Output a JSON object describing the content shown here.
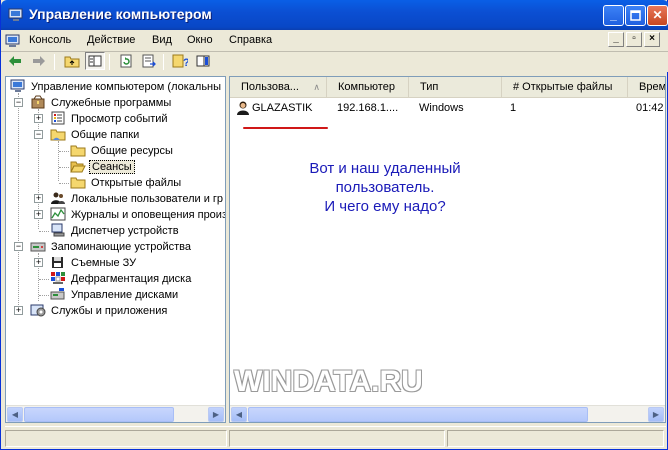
{
  "window": {
    "title": "Управление компьютером"
  },
  "menu": {
    "items": [
      "Консоль",
      "Действие",
      "Вид",
      "Окно",
      "Справка"
    ]
  },
  "tree": {
    "nodes": [
      {
        "label": "Управление компьютером (локальны",
        "icon": "computer-management-icon"
      },
      {
        "label": "Служебные программы",
        "icon": "system-tools-icon"
      },
      {
        "label": "Просмотр событий",
        "icon": "event-viewer-icon"
      },
      {
        "label": "Общие папки",
        "icon": "shared-folders-icon"
      },
      {
        "label": "Общие ресурсы",
        "icon": "folder-icon"
      },
      {
        "label": "Сеансы",
        "icon": "folder-open-icon"
      },
      {
        "label": "Открытые файлы",
        "icon": "folder-icon"
      },
      {
        "label": "Локальные пользователи и гр",
        "icon": "users-icon"
      },
      {
        "label": "Журналы и оповещения произ",
        "icon": "performance-logs-icon"
      },
      {
        "label": "Диспетчер устройств",
        "icon": "device-manager-icon"
      },
      {
        "label": "Запоминающие устройства",
        "icon": "storage-icon"
      },
      {
        "label": "Съемные ЗУ",
        "icon": "removable-storage-icon"
      },
      {
        "label": "Дефрагментация диска",
        "icon": "defrag-icon"
      },
      {
        "label": "Управление дисками",
        "icon": "disk-management-icon"
      },
      {
        "label": "Службы и приложения",
        "icon": "services-icon"
      }
    ]
  },
  "sessions": {
    "columns": [
      "Пользова...",
      "Компьютер",
      "Тип",
      "# Открытые файлы",
      "Врем"
    ],
    "rows": [
      {
        "user": "GLAZASTIK",
        "computer": "192.168.1....",
        "type": "Windows",
        "open_files": "1",
        "time": "01:42"
      }
    ]
  },
  "annotation": {
    "lines": [
      "Вот и наш удаленный",
      "пользователь.",
      "И чего ему надо?"
    ],
    "color": "#1a1ab8",
    "underline_color": "#d01818"
  },
  "watermark": "WINDATA.RU"
}
